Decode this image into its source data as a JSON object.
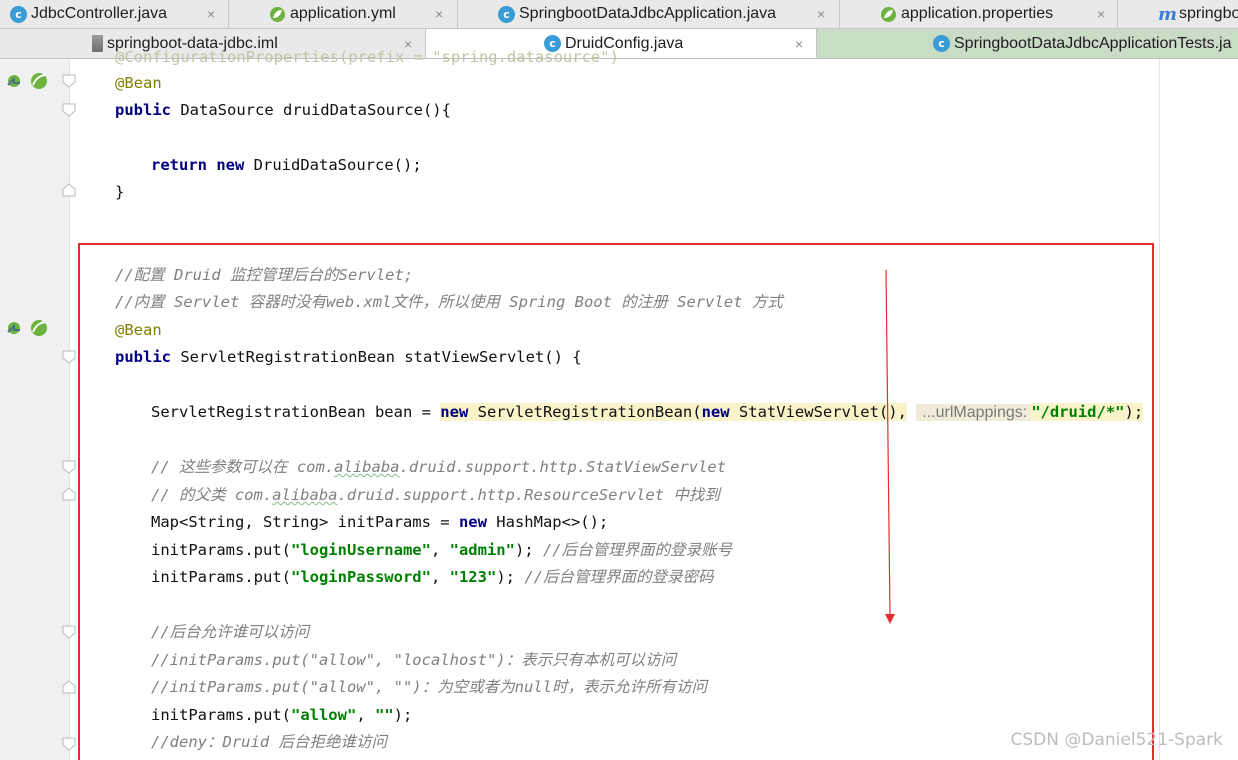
{
  "tabs_row1": [
    {
      "label": "JdbcController.java",
      "icon": "java-class-icon"
    },
    {
      "label": "application.yml",
      "icon": "spring-leaf-icon"
    },
    {
      "label": "SpringbootDataJdbcApplication.java",
      "icon": "spring-app-class-icon"
    },
    {
      "label": "application.properties",
      "icon": "spring-leaf-icon"
    },
    {
      "label": "springbo",
      "icon": "maven-icon"
    }
  ],
  "tabs_row2": [
    {
      "label": "springboot-data-jdbc.iml",
      "icon": "iml-file-icon"
    },
    {
      "label": "DruidConfig.java",
      "icon": "java-class-icon",
      "active": true
    },
    {
      "label": "SpringbootDataJdbcApplicationTests.ja",
      "icon": "spring-app-class-icon"
    }
  ],
  "close_glyph": "×",
  "code": {
    "l0": "@ConfigurationProperties(prefix = \"spring.datasource\")",
    "l1_ann": "@Bean",
    "l2_kw": "public",
    "l2_rest": " DataSource druidDataSource(){",
    "l4_kw1": "return",
    "l4_kw2": "new",
    "l4_rest": " DruidDataSource();",
    "l5": "}",
    "c1": "//配置 Druid 监控管理后台的Servlet;",
    "c2": "//内置 Servlet 容器时没有web.xml文件，所以使用 Spring Boot 的注册 Servlet 方式",
    "l9_ann": "@Bean",
    "l10_kw": "public",
    "l10_rest": " ServletRegistrationBean statViewServlet() {",
    "l12_a": "ServletRegistrationBean bean = ",
    "l12_new1": "new",
    "l12_b": " ServletRegistrationBean(",
    "l12_new2": "new",
    "l12_c": " StatViewServlet(),",
    "l12_hint": "...urlMappings:",
    "l12_str": "\"/druid/*\"",
    "l12_end": ");",
    "c3_a": "// 这些参数可以在 com.",
    "c3_wavy": "alibaba",
    "c3_b": ".druid.support.http.StatViewServlet",
    "c4_a": "// 的父类 com.",
    "c4_wavy": "alibaba",
    "c4_b": ".druid.support.http.ResourceServlet 中找到",
    "l16_a": "Map<String, String> initParams = ",
    "l16_new": "new",
    "l16_b": " HashMap<>();",
    "l17_a": "initParams.put(",
    "l17_s1": "\"loginUsername\"",
    "l17_sep": ", ",
    "l17_s2": "\"admin\"",
    "l17_end": "); ",
    "l17_cm": "//后台管理界面的登录账号",
    "l18_a": "initParams.put(",
    "l18_s1": "\"loginPassword\"",
    "l18_sep": ", ",
    "l18_s2": "\"123\"",
    "l18_end": "); ",
    "l18_cm": "//后台管理界面的登录密码",
    "c5": "//后台允许谁可以访问",
    "c6": "//initParams.put(\"allow\", \"localhost\")：表示只有本机可以访问",
    "c7": "//initParams.put(\"allow\", \"\")：为空或者为null时，表示允许所有访问",
    "l23_a": "initParams.put(",
    "l23_s1": "\"allow\"",
    "l23_sep": ", ",
    "l23_s2": "\"\"",
    "l23_end": ");",
    "c8": "//deny：Druid 后台拒绝谁访问"
  },
  "watermark": "CSDN @Daniel521-Spark",
  "colors": {
    "keyword": "#000080",
    "annotation": "#808000",
    "string": "#008000",
    "comment": "#808080",
    "highlight_box": "#e52b2b"
  }
}
